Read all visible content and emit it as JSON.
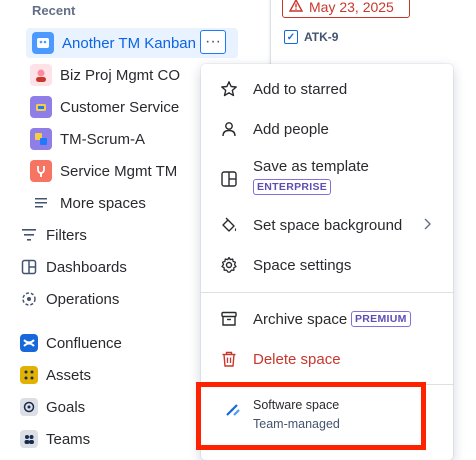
{
  "sidebar": {
    "section_title": "Recent",
    "recent": [
      {
        "label": "Another TM Kanban",
        "icon": "kanban-board-icon",
        "color": "#4c9aff"
      },
      {
        "label": "Biz Proj Mgmt CO",
        "icon": "person-avatar-icon",
        "color": "#fa8ca0"
      },
      {
        "label": "Customer Service",
        "icon": "customer-service-icon",
        "color": "#8f7ee7"
      },
      {
        "label": "TM-Scrum-A",
        "icon": "scrum-board-icon",
        "color": "#8f7ee7"
      },
      {
        "label": "Service Mgmt TM",
        "icon": "service-mgmt-icon",
        "color": "#f87462"
      }
    ],
    "more_spaces": "More spaces",
    "more_button": "···",
    "nav": [
      {
        "label": "Filters",
        "icon": "filter-icon"
      },
      {
        "label": "Dashboards",
        "icon": "dashboard-icon"
      },
      {
        "label": "Operations",
        "icon": "operations-icon"
      }
    ],
    "apps": [
      {
        "label": "Confluence",
        "icon": "confluence-icon",
        "color": "#1868db"
      },
      {
        "label": "Assets",
        "icon": "assets-icon",
        "color": "#e2b203"
      },
      {
        "label": "Goals",
        "icon": "goals-icon",
        "color": "#dcdfe4"
      },
      {
        "label": "Teams",
        "icon": "teams-icon",
        "color": "#dcdfe4"
      }
    ]
  },
  "content": {
    "date": "May 23, 2025",
    "ticket": "ATK-9"
  },
  "menu": {
    "items": [
      {
        "label": "Add to starred",
        "icon": "star-icon"
      },
      {
        "label": "Add people",
        "icon": "person-icon"
      },
      {
        "label": "Save as template",
        "icon": "template-icon",
        "badge": "ENTERPRISE"
      },
      {
        "label": "Set space background",
        "icon": "paint-bucket-icon"
      },
      {
        "label": "Space settings",
        "icon": "gear-icon"
      },
      {
        "label": "Archive space",
        "icon": "archive-icon",
        "badge": "PREMIUM"
      },
      {
        "label": "Delete space",
        "icon": "trash-icon"
      }
    ],
    "footer": {
      "title": "Software space",
      "subtitle": "Team-managed",
      "icon": "software-space-icon"
    }
  },
  "colors": {
    "accent": "#0c66e4",
    "danger": "#c9372c",
    "highlight": "#ff2200"
  }
}
